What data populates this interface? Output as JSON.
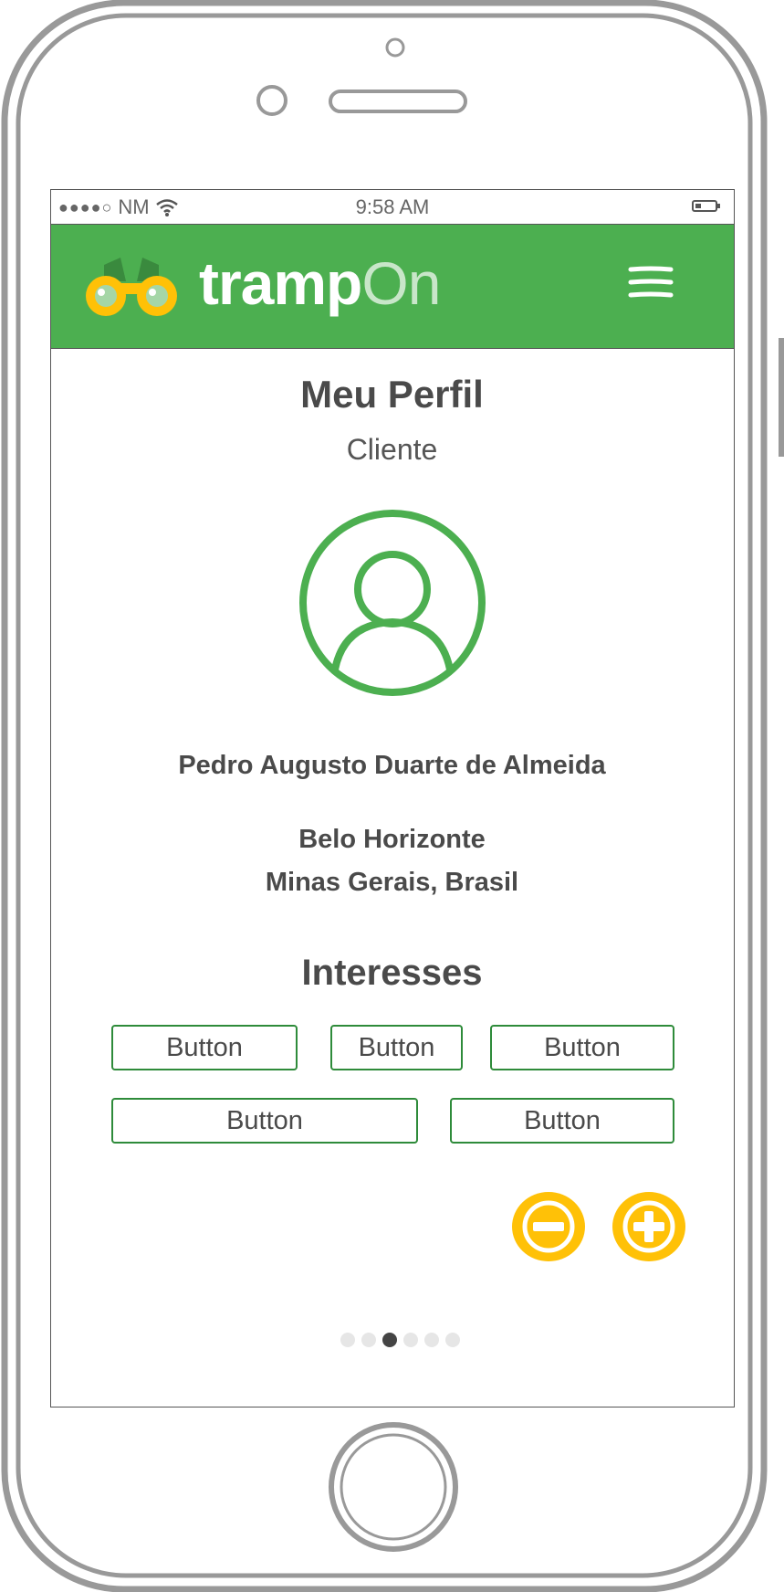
{
  "statusbar": {
    "carrier": "NM",
    "signal": "●●●●○",
    "time": "9:58 AM"
  },
  "header": {
    "brand_part1": "tramp",
    "brand_part2": "On",
    "logo_icon": "binoculars-icon",
    "menu_icon": "hamburger-menu-icon"
  },
  "profile": {
    "title": "Meu Perfil",
    "subtitle": "Cliente",
    "avatar_icon": "user-avatar-icon",
    "name": "Pedro Augusto Duarte de Almeida",
    "city": "Belo Horizonte",
    "region": "Minas Gerais, Brasil"
  },
  "interests": {
    "title": "Interesses",
    "buttons": [
      "Button",
      "Button",
      "Button",
      "Button",
      "Button"
    ],
    "remove_icon": "minus-circle-icon",
    "add_icon": "plus-circle-icon"
  },
  "pagination": {
    "total": 6,
    "active": 3
  },
  "colors": {
    "brand_green": "#4caf50",
    "accent_yellow": "#ffc107",
    "text_dark": "#4a4a4a"
  }
}
